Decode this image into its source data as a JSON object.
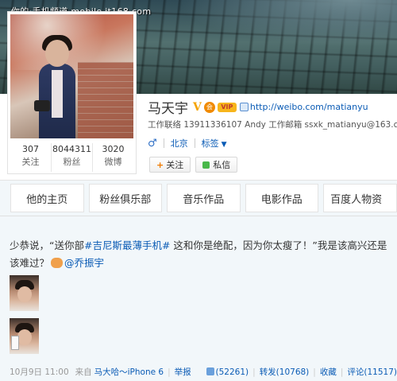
{
  "watermark": "你的·手机频道 mobile.it168.com",
  "profile": {
    "name": "马天宇",
    "verified_mark": "V",
    "badge_text": "会",
    "vip_text": "VIP",
    "url": "http://weibo.com/matianyu",
    "contact": "工作联络 13911336107 Andy 工作邮箱 ssxk_matianyu@163.com",
    "gender": "♂",
    "location": "北京",
    "tags_label": "标签",
    "stats": [
      {
        "value": "307",
        "label": "关注"
      },
      {
        "value": "8044311",
        "label": "粉丝"
      },
      {
        "value": "3020",
        "label": "微博"
      }
    ],
    "follow_label": "关注",
    "message_label": "私信"
  },
  "tabs": [
    {
      "label": "他的主页"
    },
    {
      "label": "粉丝俱乐部"
    },
    {
      "label": "音乐作品"
    },
    {
      "label": "电影作品"
    },
    {
      "label": "百度人物资"
    }
  ],
  "post": {
    "text_start": "少恭说，“送你部",
    "topic": "#吉尼斯最薄手机#",
    "text_mid": " 这和你是绝配，因为你太瘦了！”我是该高兴还是该难过？",
    "mention": "@乔振宇",
    "date": "10月9日 11:00",
    "from_label": "来自",
    "source": "马大哈～iPhone 6",
    "report_label": "举报",
    "likes": "(52261)",
    "repost_label": "转发(10768)",
    "fav_label": "收藏",
    "comment_label": "评论(11517)"
  },
  "colors": {
    "link": "#0a5bb5",
    "verified": "#f5a300",
    "page_bg": "#f2f7fa"
  }
}
